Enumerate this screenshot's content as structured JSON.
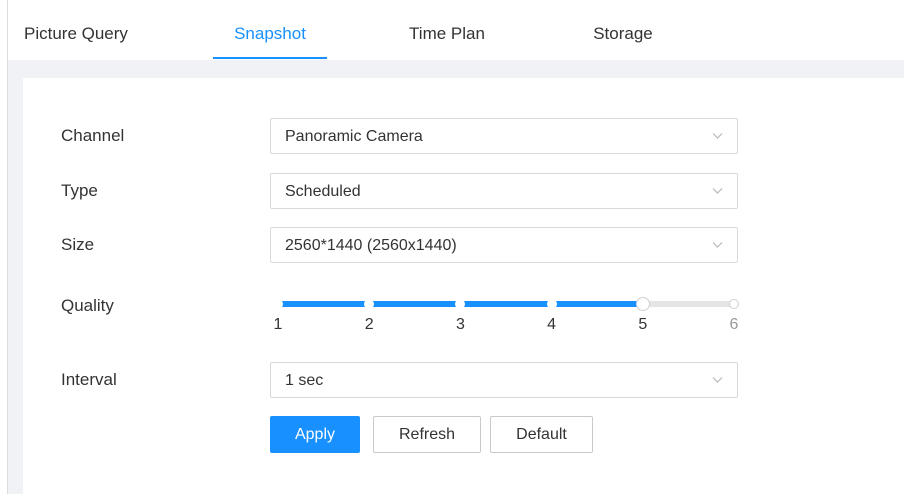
{
  "tabs": [
    {
      "label": "Picture Query",
      "active": false
    },
    {
      "label": "Snapshot",
      "active": true
    },
    {
      "label": "Time Plan",
      "active": false
    },
    {
      "label": "Storage",
      "active": false
    }
  ],
  "form": {
    "channel": {
      "label": "Channel",
      "value": "Panoramic Camera"
    },
    "type": {
      "label": "Type",
      "value": "Scheduled"
    },
    "size": {
      "label": "Size",
      "value": "2560*1440 (2560x1440)"
    },
    "quality": {
      "label": "Quality",
      "value": 5,
      "min": 1,
      "max": 6,
      "marks": [
        "1",
        "2",
        "3",
        "4",
        "5",
        "6"
      ]
    },
    "interval": {
      "label": "Interval",
      "value": "1 sec"
    }
  },
  "buttons": {
    "apply": "Apply",
    "refresh": "Refresh",
    "default": "Default"
  },
  "colors": {
    "accent": "#1890ff",
    "background": "#f0f2f5"
  },
  "icons": {
    "dropdown": "chevron-down-icon"
  }
}
